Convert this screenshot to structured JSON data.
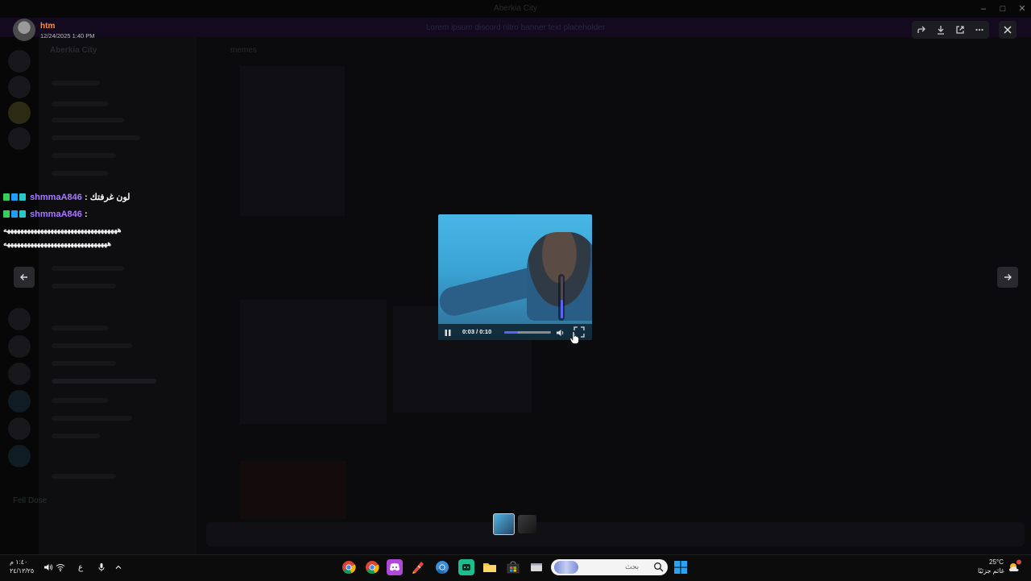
{
  "background_app": {
    "window_title": "Aberkia City",
    "banner_text": "Lorem ipsum discord nitro banner text placeholder",
    "server_name": "Aberkia City",
    "channel_name": "memes",
    "user_panel_name": "Fell Dose"
  },
  "viewer": {
    "author_name": "htm",
    "timestamp": "12/24/2025 1:40 PM",
    "actions": {
      "forward": "forward-icon",
      "download": "download-icon",
      "open_external": "external-link-icon",
      "more": "more-icon"
    },
    "close": "close-icon"
  },
  "chat_overlay": {
    "messages": [
      {
        "user": "shmmaA846",
        "text": ": لون غرفتك"
      },
      {
        "user": "shmmaA846",
        "text": ":"
      }
    ],
    "continuation_lines": [
      "ههههههههههههههههههههههههههههههههههه",
      "هههههههههههههههههههههههههههههههه"
    ]
  },
  "video": {
    "time_text": "0:03 / 0:10",
    "progress_fraction": 0.3,
    "volume_fraction": 0.45,
    "accent_color": "#5865f2"
  },
  "taskbar": {
    "clock_time": "١:٤٠ م",
    "clock_date": "٢٤/١٢/٢٥",
    "keyboard_lang": "ع",
    "search_placeholder": "بحث",
    "weather_temp": "25°C",
    "weather_text": "غائم جزئيًا",
    "apps": [
      "chrome-icon",
      "chrome-icon",
      "discord-icon",
      "app-icon",
      "chrome-icon",
      "app-icon",
      "file-explorer-icon",
      "store-icon",
      "app-icon"
    ]
  }
}
